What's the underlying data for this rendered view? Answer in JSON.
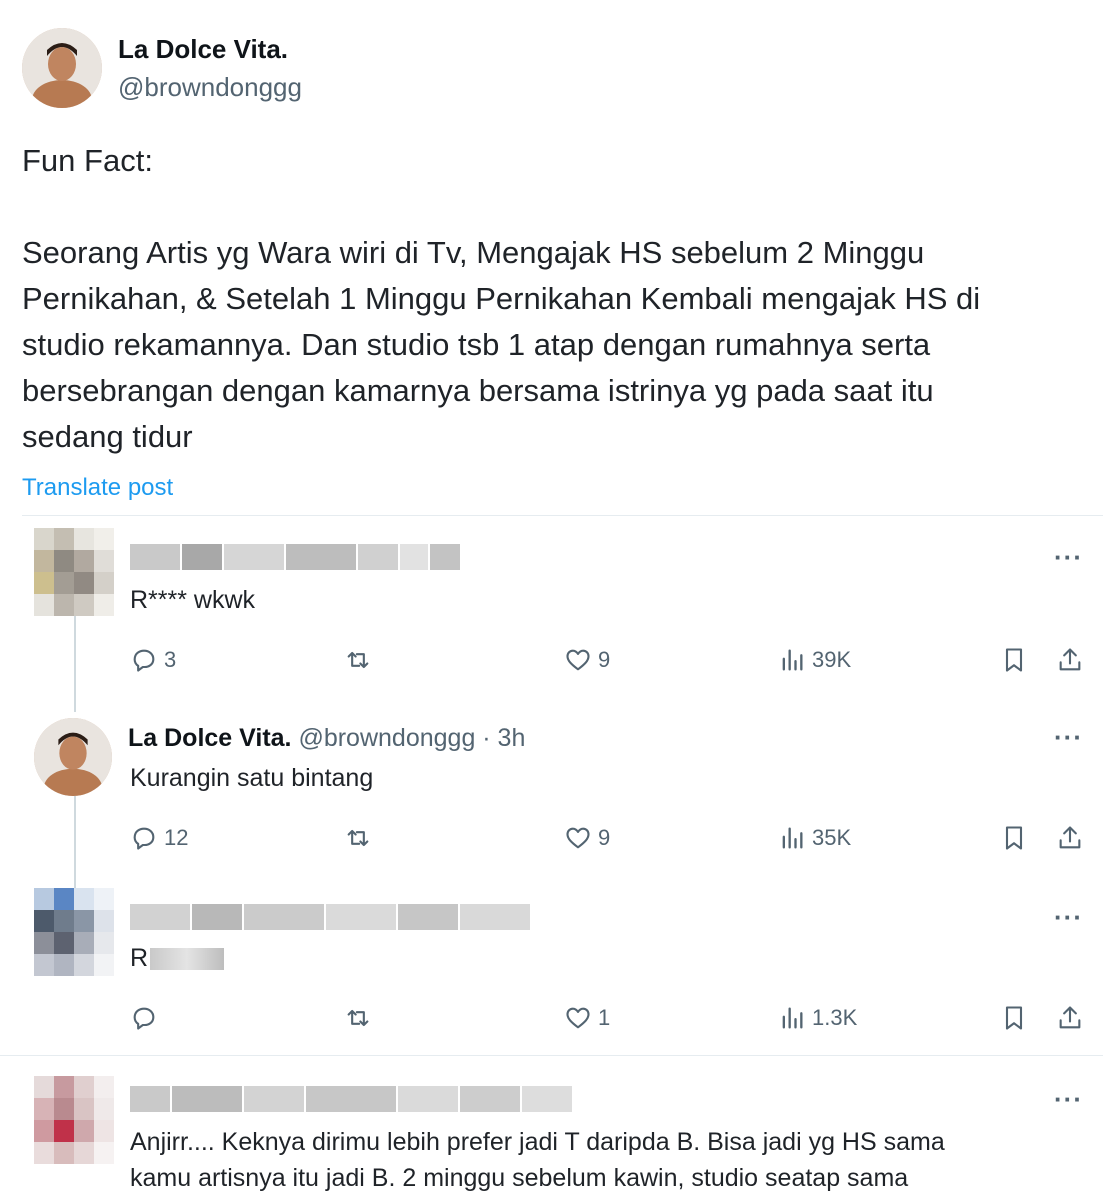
{
  "post": {
    "author_name": "La Dolce Vita.",
    "author_handle": "@browndonggg",
    "text_line1": "Fun Fact:",
    "text_lines": [
      "Seorang Artis yg Wara wiri di Tv, Mengajak HS sebelum 2 Minggu",
      "Pernikahan, & Setelah 1 Minggu Pernikahan Kembali mengajak HS di",
      "studio rekamannya. Dan studio tsb 1 atap dengan rumahnya serta",
      "bersebrangan dengan kamarnya bersama istrinya yg pada saat itu",
      "sedang tidur"
    ],
    "translate_label": "Translate post"
  },
  "replies": [
    {
      "text": "R**** wkwk",
      "stats": {
        "replies": "3",
        "likes": "9",
        "views": "39K"
      }
    },
    {
      "author_name": "La Dolce Vita.",
      "author_handle": "@browndonggg · 3h",
      "text": "Kurangin satu bintang",
      "stats": {
        "replies": "12",
        "likes": "9",
        "views": "35K"
      }
    },
    {
      "text_prefix": "R",
      "stats": {
        "replies": "",
        "likes": "1",
        "views": "1.3K"
      }
    },
    {
      "text_lines": [
        "Anjirr.... Keknya dirimu lebih prefer jadi T daripda B. Bisa jadi yg HS sama",
        "kamu artisnya itu jadi B. 2 minggu sebelum kawin, studio seatap sama"
      ]
    }
  ],
  "more_label": "···",
  "icons": {
    "reply": "comment-icon",
    "repost": "repost-icon",
    "like": "heart-icon",
    "views": "views-chart-icon",
    "bookmark": "bookmark-icon",
    "share": "share-icon"
  },
  "colors": {
    "link": "#1d9bf0",
    "muted": "#536471",
    "text": "#0f1419"
  }
}
